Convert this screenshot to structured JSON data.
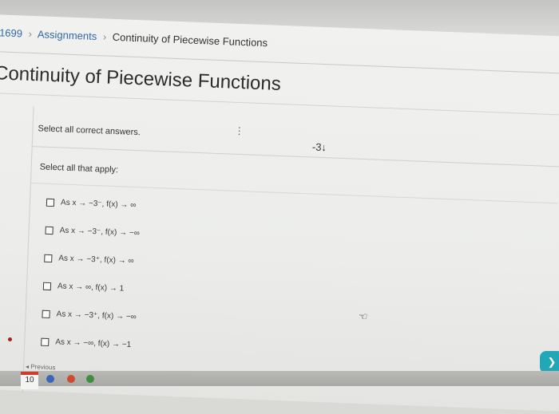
{
  "breadcrumb": {
    "course": "1699",
    "assignments": "Assignments",
    "current": "Continuity of Piecewise Functions"
  },
  "page_title": "Continuity of Piecewise Functions",
  "question": {
    "instruction": "Select all correct answers.",
    "prompt": "Select all that apply:",
    "options": [
      "As x → −3⁻, f(x) → ∞",
      "As x → −3⁻, f(x) → −∞",
      "As x → −3⁺, f(x) → ∞",
      "As x → ∞, f(x) → 1",
      "As x → −3⁺, f(x) → −∞",
      "As x → −∞, f(x) → −1"
    ]
  },
  "graph_note": "-3↓",
  "previous_label": "◂ Previous",
  "taskbar": {
    "calendar_day": "10"
  },
  "colors": {
    "link": "#2f6aa8",
    "chat_bubble": "#20a7b8",
    "calendar_red": "#d03a2f"
  },
  "icons": {
    "chat": "chat-bubble-icon",
    "cursor": "hand-cursor-icon"
  }
}
